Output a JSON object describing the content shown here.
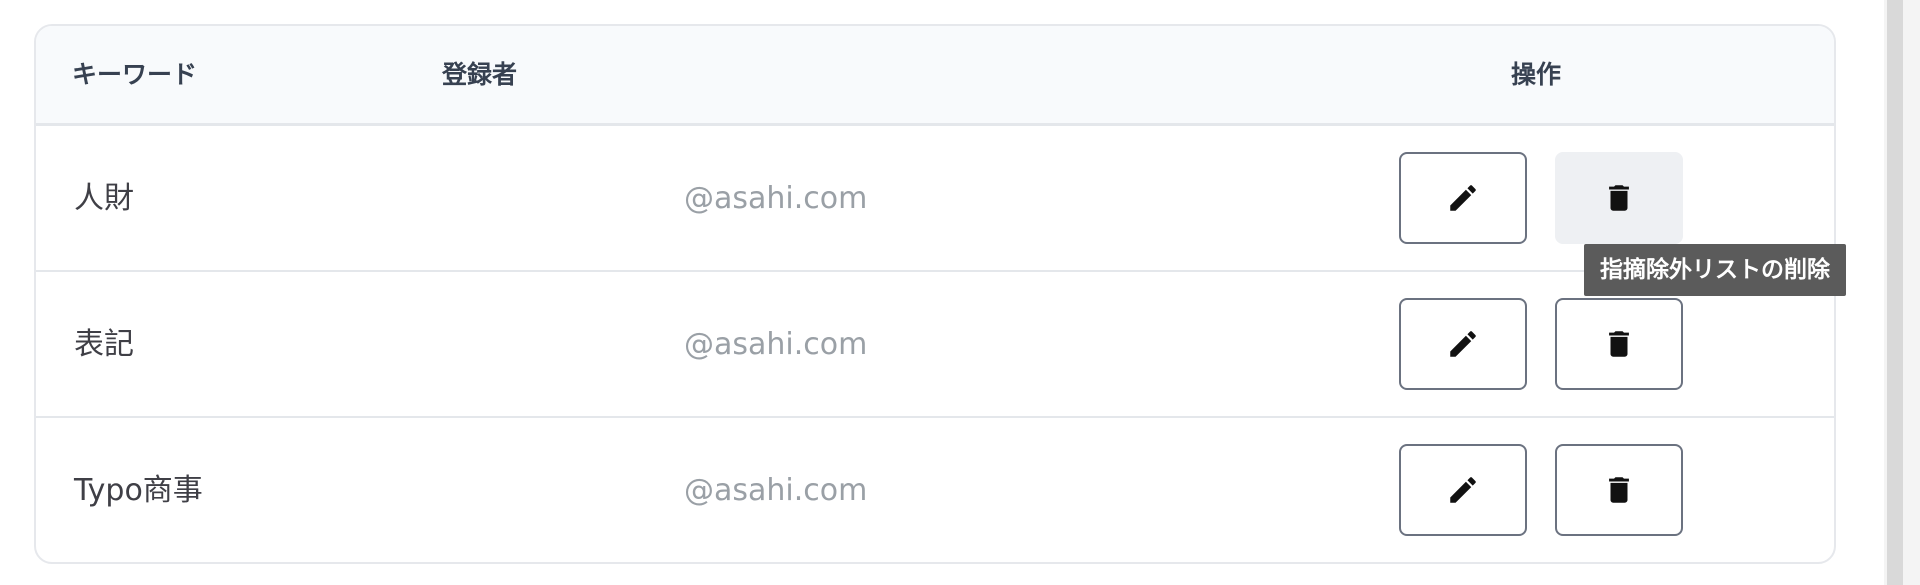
{
  "table": {
    "headers": {
      "keyword": "キーワード",
      "registrant": "登録者",
      "actions": "操作"
    },
    "rows": [
      {
        "keyword": "人財",
        "registrant": "@asahi.com"
      },
      {
        "keyword": "表記",
        "registrant": "@asahi.com"
      },
      {
        "keyword": "Typo商事",
        "registrant": "@asahi.com"
      }
    ]
  },
  "tooltip": {
    "text": "指摘除外リストの削除"
  },
  "icons": {
    "edit": "pencil-icon",
    "delete": "trash-icon"
  },
  "colors": {
    "header_bg": "#f8fafc",
    "border": "#e4e7eb",
    "button_border": "#6b7280",
    "hover_bg": "#eef0f3",
    "tooltip_bg": "#5b5b5b",
    "email_text": "#9aa0a6"
  }
}
